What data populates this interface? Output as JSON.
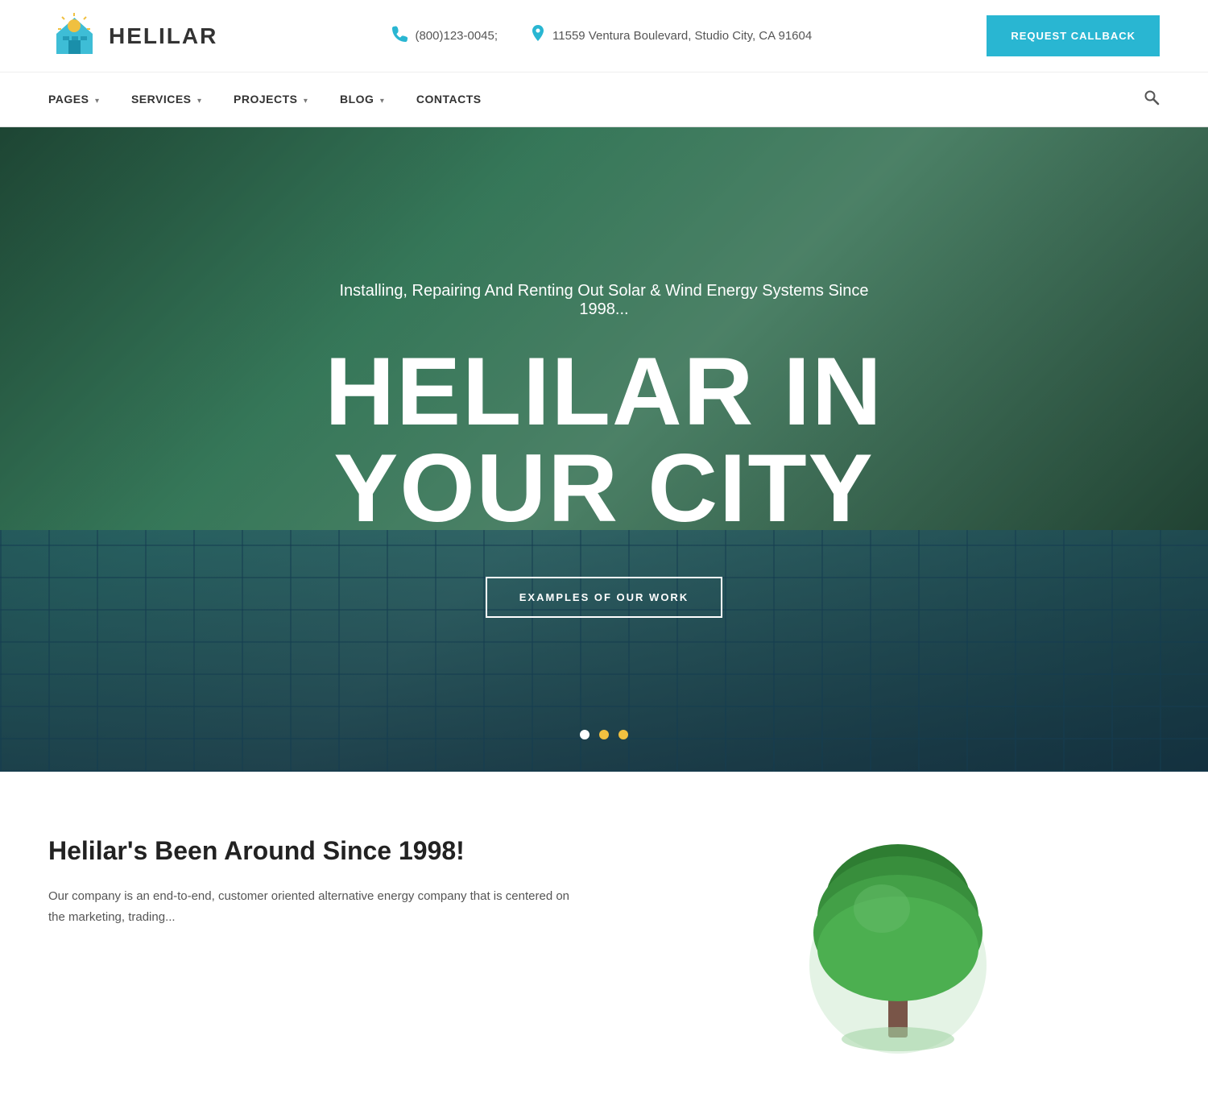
{
  "header": {
    "logo_text": "HELILAR",
    "phone": "(800)123-0045;",
    "address": "11559 Ventura Boulevard, Studio City, CA 91604",
    "callback_btn": "REQUEST CALLBACK"
  },
  "nav": {
    "items": [
      {
        "label": "PAGES",
        "has_dropdown": true
      },
      {
        "label": "SERVICES",
        "has_dropdown": true
      },
      {
        "label": "PROJECTS",
        "has_dropdown": true
      },
      {
        "label": "BLOG",
        "has_dropdown": true
      },
      {
        "label": "CONTACTS",
        "has_dropdown": false
      }
    ]
  },
  "hero": {
    "subtitle": "Installing, Repairing And Renting Out Solar & Wind Energy Systems Since 1998...",
    "title_line1": "HELILAR IN",
    "title_line2": "YOUR CITY",
    "cta_btn": "EXAMPLES OF OUR WORK",
    "dots": [
      {
        "state": "active"
      },
      {
        "state": "dot2"
      },
      {
        "state": "dot3"
      }
    ]
  },
  "about": {
    "title": "Helilar's Been Around Since 1998!",
    "text": "Our company is an end-to-end, customer oriented alternative energy company that is centered on the marketing, trading..."
  },
  "icons": {
    "phone_icon": "📞",
    "address_icon": "🏠",
    "search_icon": "🔍"
  }
}
